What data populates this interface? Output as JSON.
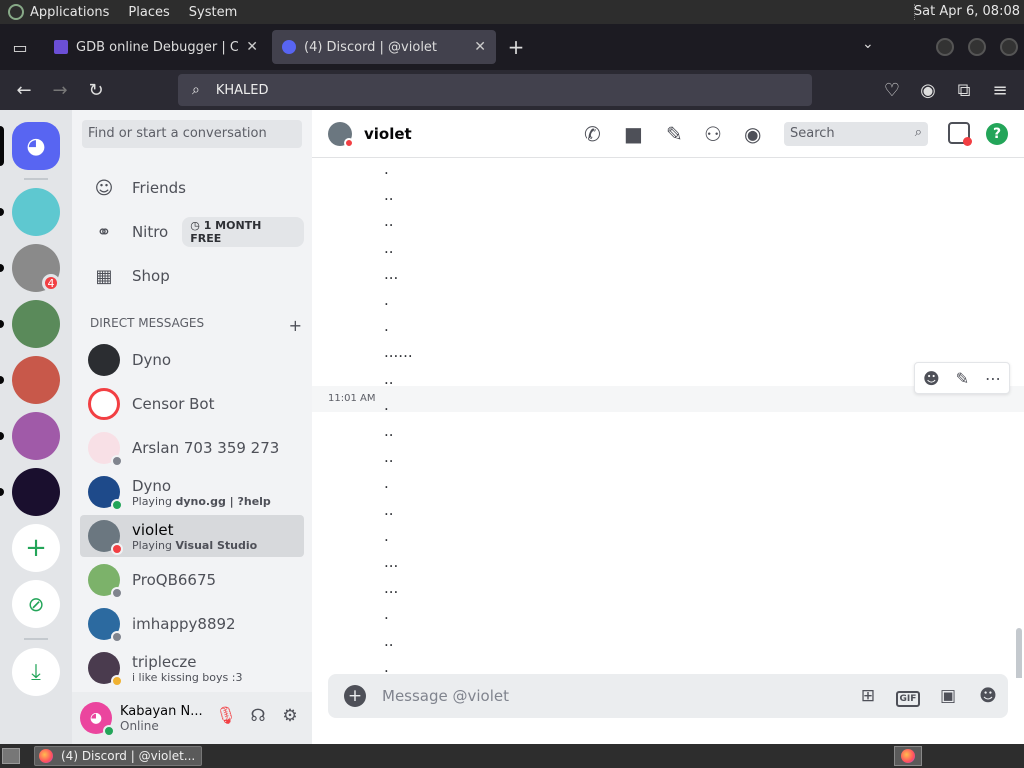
{
  "system_panel": {
    "menus": [
      "Applications",
      "Places",
      "System"
    ],
    "clock": "Sat Apr  6, 08:08"
  },
  "browser": {
    "tabs": [
      {
        "title": "GDB online Debugger | Compiler - Code, Compile, Run, Debug online C, C++",
        "active": false
      },
      {
        "title": "(4) Discord | @violet",
        "active": true
      }
    ],
    "address_bar": "KHALED"
  },
  "discord": {
    "guild_badge": "4",
    "channels": {
      "find_placeholder": "Find or start a conversation",
      "nav": [
        {
          "label": "Friends",
          "icon": "friends-icon"
        },
        {
          "label": "Nitro",
          "icon": "nitro-icon",
          "badge": "1 MONTH FREE"
        },
        {
          "label": "Shop",
          "icon": "shop-icon"
        }
      ],
      "dm_header": "Direct Messages",
      "dms": [
        {
          "name": "Dyno",
          "sub": "",
          "avatar_color": "#2b2d31",
          "status": ""
        },
        {
          "name": "Censor Bot",
          "sub": "",
          "avatar_color": "#ffffff",
          "status": ""
        },
        {
          "name": "Arslan 703 359 273",
          "sub": "",
          "avatar_color": "#f8e0e6",
          "status": "offline"
        },
        {
          "name": "Dyno",
          "sub_prefix": "Playing ",
          "sub_bold": "dyno.gg | ?help",
          "avatar_color": "#1e4a8a",
          "status": "online"
        },
        {
          "name": "violet",
          "sub_prefix": "Playing ",
          "sub_bold": "Visual Studio",
          "avatar_color": "#6b7780",
          "status": "dnd",
          "selected": true
        },
        {
          "name": "ProQB6675",
          "sub": "",
          "avatar_color": "#7cb26a",
          "status": "offline"
        },
        {
          "name": "imhappy8892",
          "sub": "",
          "avatar_color": "#2c6aa0",
          "status": "offline"
        },
        {
          "name": "triplecze",
          "sub": "i like kissing boys :3",
          "avatar_color": "#4a3b4e",
          "status": "idle"
        }
      ]
    },
    "user_panel": {
      "name": "Kabayan N...",
      "status": "Online"
    },
    "chat": {
      "recipient": "violet",
      "search_placeholder": "Search",
      "timestamp": "11:01 AM",
      "messages": [
        ".",
        "..",
        "..",
        "..",
        "...",
        ".",
        ".",
        "......",
        "..",
        ".",
        "..",
        "..",
        ".",
        "..",
        ".",
        "...",
        "...",
        ".",
        "..",
        "."
      ],
      "composer_placeholder": "Message @violet",
      "gif_label": "GIF"
    }
  },
  "taskbar": {
    "window_title": "(4) Discord | @violet..."
  },
  "colors": {
    "blurple": "#5865f2",
    "green": "#23a559",
    "red": "#f23f43"
  }
}
